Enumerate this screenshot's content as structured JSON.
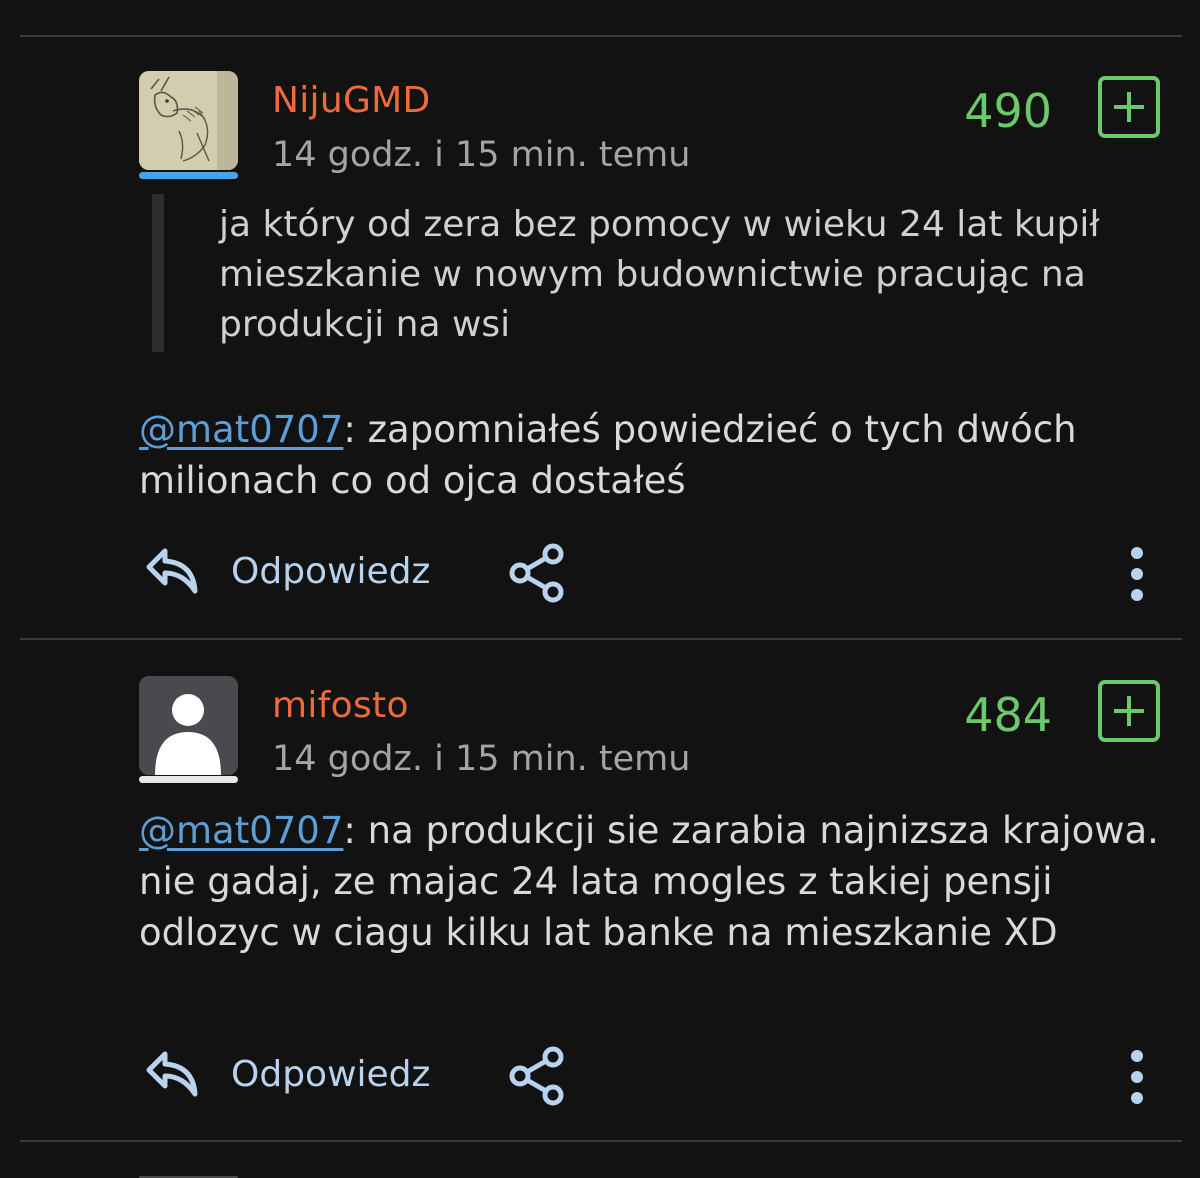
{
  "comments": [
    {
      "username": "NijuGMD",
      "timestamp": "14 godz. i 15 min. temu",
      "score": "490",
      "avatar": "sketch-avatar",
      "quote": "ja który od zera bez pomocy w wieku 24 lat kupił\nmieszkanie w nowym budownictwie pracując na\nprodukcji na wsi",
      "mention": "@mat0707",
      "body": ": zapomniałeś powiedzieć o tych dwóch milionach co od ojca dostałeś",
      "reply_label": "Odpowiedz"
    },
    {
      "username": "mifosto",
      "timestamp": "14 godz. i 15 min. temu",
      "score": "484",
      "avatar": "default-user-avatar",
      "mention": "@mat0707",
      "body": ": na produkcji sie zarabia najnizsza krajowa. nie gadaj, ze majac 24 lata mogles z takiej pensji odlozyc w ciagu kilku lat banke na mieszkanie XD",
      "reply_label": "Odpowiedz"
    }
  ],
  "colors": {
    "background": "#121212",
    "username": "#ef6a3a",
    "score": "#6cc96a",
    "mention": "#5d9ed6",
    "action": "#b9d3ee",
    "avatar_line_1": "#4aa3e6",
    "avatar_line_2": "#e8e8e8"
  },
  "icons": [
    "reply-icon",
    "share-icon",
    "more-vertical-icon",
    "plus-icon"
  ]
}
